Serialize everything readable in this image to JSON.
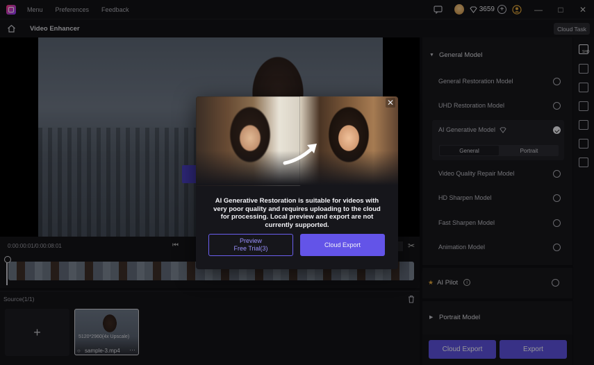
{
  "titlebar": {
    "menu": "Menu",
    "preferences": "Preferences",
    "feedback": "Feedback",
    "gem_count": "3659"
  },
  "toolbar": {
    "page_title": "Video Enhancer",
    "cloud_task": "Cloud Task"
  },
  "timeline": {
    "timecode": "0:00:00:01/0:00:08:01"
  },
  "source": {
    "label": "Source(1/1)",
    "add_symbol": "+",
    "file": {
      "resolution": "5120*2960(4x Upscale)",
      "name": "sample-3.mp4",
      "more": "···"
    }
  },
  "right_panel": {
    "general_model_title": "General Model",
    "models": [
      {
        "label": "General Restoration Model",
        "checked": false
      },
      {
        "label": "UHD Restoration Model",
        "checked": false
      },
      {
        "label": "AI Generative Model",
        "checked": true
      },
      {
        "label": "Video Quality Repair Model",
        "checked": false
      },
      {
        "label": "HD Sharpen Model",
        "checked": false
      },
      {
        "label": "Fast Sharpen Model",
        "checked": false
      },
      {
        "label": "Animation Model",
        "checked": false
      }
    ],
    "ai_options": [
      "General",
      "Portrait"
    ],
    "ai_pilot": "AI Pilot",
    "portrait_model_title": "Portrait Model",
    "cloud_export": "Cloud Export",
    "export": "Export"
  },
  "tool_strip": {
    "tag": "SHD"
  },
  "modal": {
    "description": "AI Generative Restoration is suitable for videos with very poor quality and requires uploading to the cloud for processing. Local preview and export are not currently supported.",
    "preview_line1": "Preview",
    "preview_line2": "Free Trial(3)",
    "cloud_export": "Cloud Export"
  },
  "colors": {
    "accent": "#5b4fd9",
    "modal_button": "#6354e8",
    "background": "#0f0f12"
  }
}
